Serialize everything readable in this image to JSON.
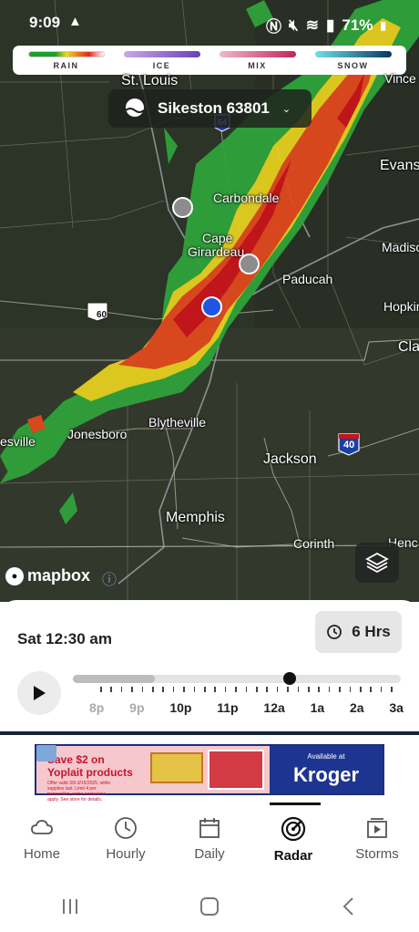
{
  "status": {
    "time": "9:09",
    "battery": "71%"
  },
  "legend": [
    {
      "label": "RAIN",
      "colors": [
        "#1e9e2a",
        "#f2d61b",
        "#e02a1a",
        "#ffffff"
      ]
    },
    {
      "label": "ICE",
      "colors": [
        "#c9a8e8",
        "#6a3fb5"
      ]
    },
    {
      "label": "MIX",
      "colors": [
        "#f0b8c8",
        "#c2235f"
      ]
    },
    {
      "label": "SNOW",
      "colors": [
        "#6fe0ea",
        "#0a3560"
      ]
    }
  ],
  "location": {
    "name": "Sikeston 63801"
  },
  "cities": {
    "st_louis": "St. Louis",
    "vincennes": "Vince",
    "evansville": "Evansv",
    "carbondale": "Carbondale",
    "cape": "Cape",
    "girardeau": "Girardeau",
    "madison": "Madiso",
    "paducah": "Paducah",
    "hopkins": "Hopkin",
    "clarks": "Cla",
    "blytheville": "Blytheville",
    "jonesboro": "Jonesboro",
    "esville": "esville",
    "jackson": "Jackson",
    "memphis": "Memphis",
    "corinth": "Corinth",
    "henderson": "Henc"
  },
  "shields": {
    "us60": "60",
    "i64": "64",
    "i40": "40"
  },
  "attribution": "mapbox",
  "timeline": {
    "current": "Sat 12:30 am",
    "range_label": "6 Hrs",
    "progress": 0.66,
    "hours": [
      "8p",
      "9p",
      "10p",
      "11p",
      "12a",
      "1a",
      "2a",
      "3a"
    ]
  },
  "ad": {
    "headline1": "Save $2 on",
    "headline2": "Yoplait products",
    "fine": "Offer valid 3/9-3/15/2025, while supplies last. Limit 4 per transaction, some exclusions apply. See store for details.",
    "available": "Available at",
    "brand": "Kroger"
  },
  "nav": [
    {
      "label": "Home",
      "icon": "cloud-icon"
    },
    {
      "label": "Hourly",
      "icon": "clock-icon"
    },
    {
      "label": "Daily",
      "icon": "calendar-icon"
    },
    {
      "label": "Radar",
      "icon": "radar-icon",
      "active": true
    },
    {
      "label": "Storms",
      "icon": "storms-play-icon"
    }
  ]
}
